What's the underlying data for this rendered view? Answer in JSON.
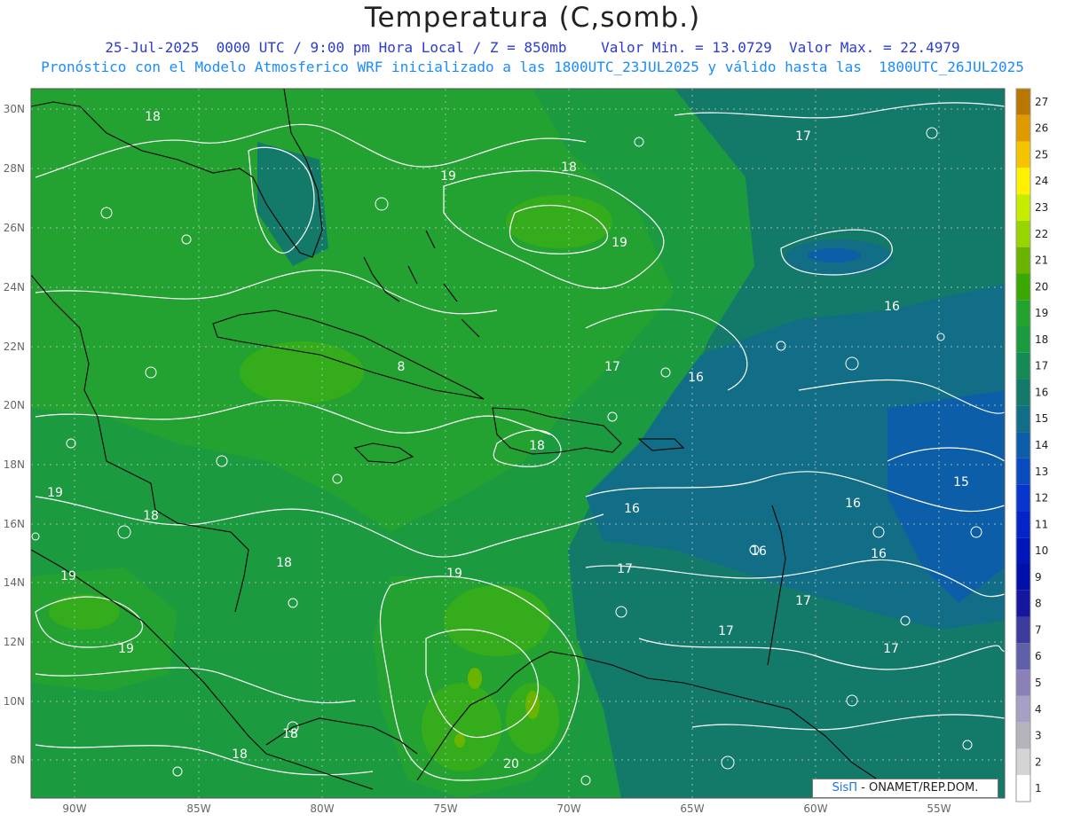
{
  "header": {
    "title": "Temperatura (C,somb.)",
    "line1": "25-Jul-2025  0000 UTC / 9:00 pm Hora Local / Z = 850mb    Valor Min. = 13.0729  Valor Max. = 22.4979",
    "line2": "Pronóstico con el Modelo Atmosferico WRF inicializado a las 1800UTC_23JUL2025 y válido hasta las  1800UTC_26JUL2025"
  },
  "map": {
    "lat_labels": [
      "30N",
      "28N",
      "26N",
      "24N",
      "22N",
      "20N",
      "18N",
      "16N",
      "14N",
      "12N",
      "10N",
      "8N"
    ],
    "lon_labels": [
      "90W",
      "85W",
      "80W",
      "75W",
      "70W",
      "65W",
      "60W",
      "55W"
    ],
    "contour_labels": [
      {
        "text": "18",
        "id": "a"
      },
      {
        "text": "17",
        "id": "b"
      },
      {
        "text": "19",
        "id": "c"
      },
      {
        "text": "18",
        "id": "d"
      },
      {
        "text": "19",
        "id": "e"
      },
      {
        "text": "16",
        "id": "f"
      },
      {
        "text": "8",
        "id": "g"
      },
      {
        "text": "17",
        "id": "h"
      },
      {
        "text": "16",
        "id": "i"
      },
      {
        "text": "18",
        "id": "j"
      },
      {
        "text": "19",
        "id": "k"
      },
      {
        "text": "18",
        "id": "l"
      },
      {
        "text": "16",
        "id": "m"
      },
      {
        "text": "16",
        "id": "n"
      },
      {
        "text": "15",
        "id": "o"
      },
      {
        "text": "16",
        "id": "p"
      },
      {
        "text": "18",
        "id": "q"
      },
      {
        "text": "19",
        "id": "r"
      },
      {
        "text": "16",
        "id": "s"
      },
      {
        "text": "17",
        "id": "t"
      },
      {
        "text": "19",
        "id": "u"
      },
      {
        "text": "17",
        "id": "v"
      },
      {
        "text": "17",
        "id": "w"
      },
      {
        "text": "19",
        "id": "x"
      },
      {
        "text": "17",
        "id": "y"
      },
      {
        "text": "18",
        "id": "z"
      },
      {
        "text": "18",
        "id": "aa"
      },
      {
        "text": "20",
        "id": "ab"
      }
    ]
  },
  "colorbar": {
    "labels": [
      "27",
      "26",
      "25",
      "24",
      "23",
      "22",
      "21",
      "20",
      "19",
      "18",
      "17",
      "16",
      "15",
      "14",
      "13",
      "12",
      "11",
      "10",
      "9",
      "8",
      "7",
      "6",
      "5",
      "4",
      "3",
      "2",
      "1"
    ],
    "colors": [
      "#b87800",
      "#e09a00",
      "#f5c400",
      "#fff200",
      "#c8ec00",
      "#98d400",
      "#6ab400",
      "#3aa800",
      "#24a230",
      "#1c9a40",
      "#168a54",
      "#137a6a",
      "#116e86",
      "#0c5ea8",
      "#0a4cc0",
      "#0836cc",
      "#0424c8",
      "#0016b8",
      "#0010a8",
      "#16169e",
      "#3c3c9c",
      "#6060a8",
      "#8c80b8",
      "#a8a0c4",
      "#b4b4bc",
      "#d4d4d4",
      "#ffffff"
    ]
  },
  "credit": {
    "brand": "SisΠ",
    "text": "- ONAMET/REP.DOM."
  }
}
